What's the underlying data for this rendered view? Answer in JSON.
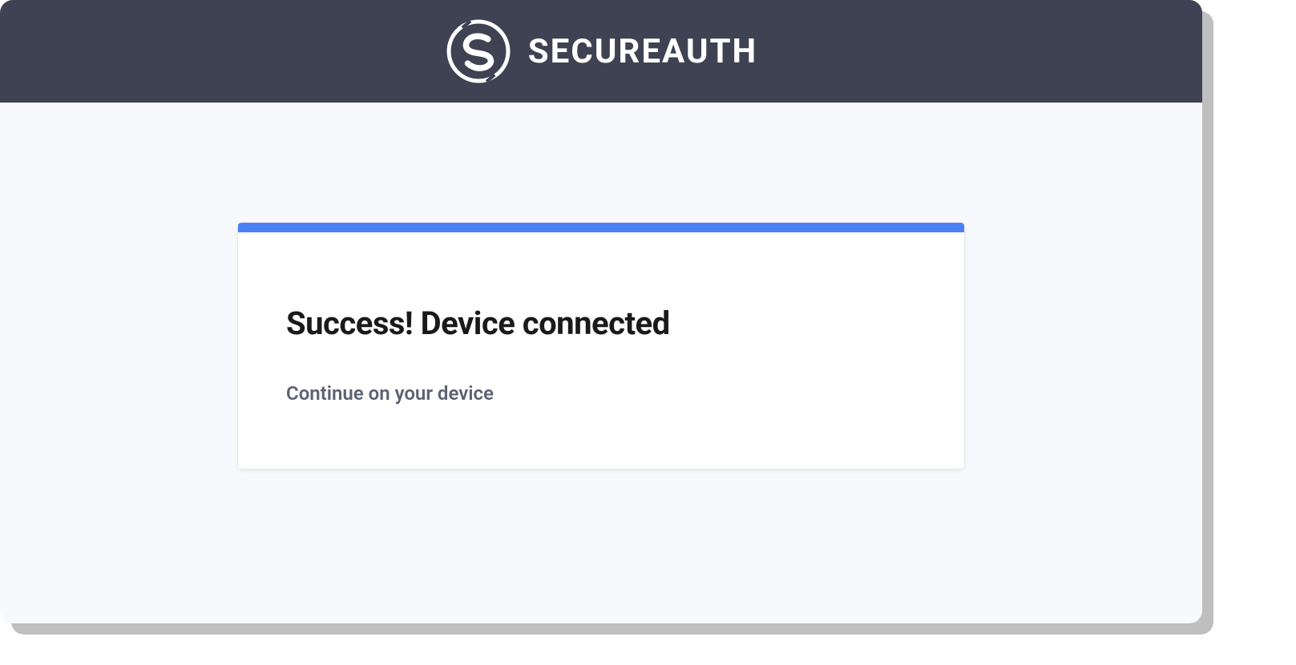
{
  "header": {
    "brand_name": "SECUREAUTH",
    "logo_name": "secureauth-logo"
  },
  "card": {
    "title": "Success! Device connected",
    "subtitle": "Continue on your device"
  },
  "colors": {
    "header_bg": "#3f4252",
    "accent": "#4a82f6",
    "page_bg": "#f8f9fc"
  }
}
